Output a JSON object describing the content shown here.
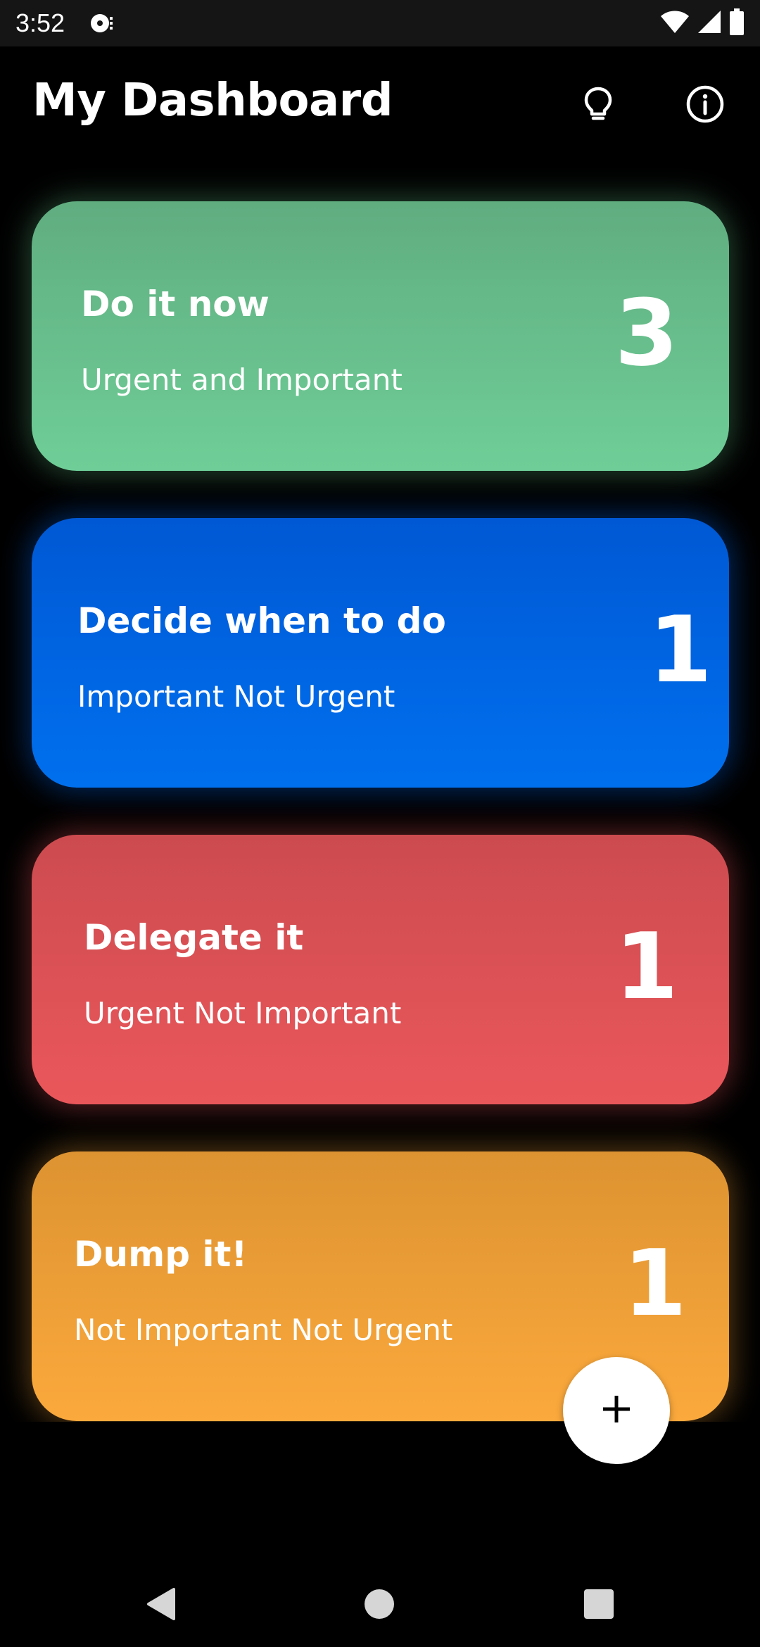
{
  "status_bar": {
    "time": "3:52",
    "app_icon": "media-disc-icon",
    "icons": [
      "wifi-icon",
      "signal-icon",
      "battery-icon"
    ]
  },
  "app_bar": {
    "title": "My Dashboard",
    "actions": [
      {
        "icon": "lightbulb-icon"
      },
      {
        "icon": "info-icon"
      }
    ]
  },
  "cards": [
    {
      "title": "Do it now",
      "subtitle": "Urgent and Important",
      "count": "3",
      "color": "#6ac591"
    },
    {
      "title": "Decide when to do",
      "subtitle": "Important Not Urgent",
      "count": "1",
      "color": "#0066e4"
    },
    {
      "title": "Delegate it",
      "subtitle": "Urgent Not Important",
      "count": "1",
      "color": "#e25357"
    },
    {
      "title": "Dump it!",
      "subtitle": "Not Important Not Urgent",
      "count": "1",
      "color": "#f2a038"
    }
  ],
  "fab": {
    "icon": "plus-icon"
  },
  "nav_bar": {
    "icons": [
      "back-icon",
      "home-icon",
      "recents-icon"
    ]
  }
}
